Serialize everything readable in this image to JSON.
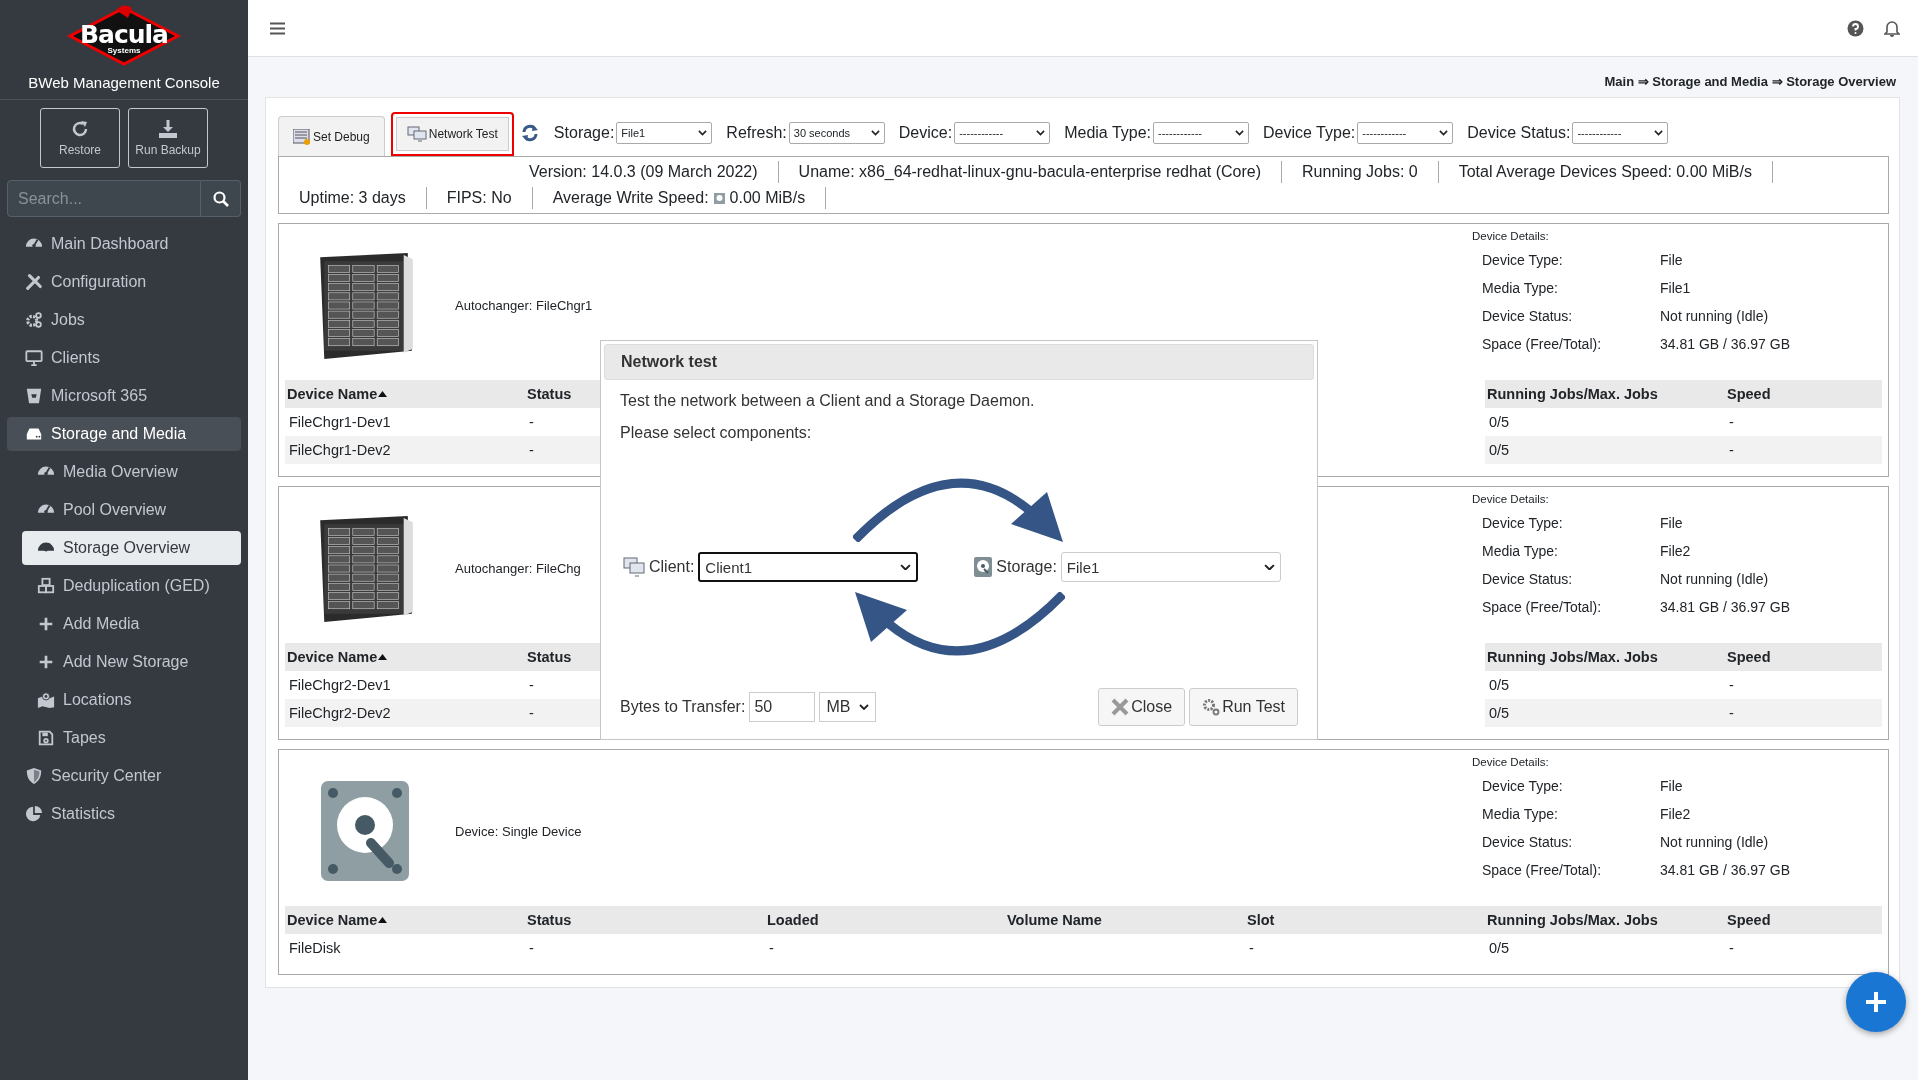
{
  "sidebar": {
    "logo": {
      "name": "Bacula",
      "subtitle": "Systems"
    },
    "title": "BWeb Management Console",
    "actions": [
      {
        "label": "Restore"
      },
      {
        "label": "Run Backup"
      }
    ],
    "search": {
      "placeholder": "Search..."
    },
    "menu": [
      {
        "label": "Main Dashboard",
        "selected": false
      },
      {
        "label": "Configuration",
        "selected": false
      },
      {
        "label": "Jobs",
        "selected": false
      },
      {
        "label": "Clients",
        "selected": false
      },
      {
        "label": "Microsoft 365",
        "selected": false
      },
      {
        "label": "Storage and Media",
        "selected": true,
        "children": [
          {
            "label": "Media Overview",
            "selected": false
          },
          {
            "label": "Pool Overview",
            "selected": false
          },
          {
            "label": "Storage Overview",
            "selected": true
          },
          {
            "label": "Deduplication (GED)",
            "selected": false
          },
          {
            "label": "Add Media",
            "selected": false
          },
          {
            "label": "Add New Storage",
            "selected": false
          },
          {
            "label": "Locations",
            "selected": false
          },
          {
            "label": "Tapes",
            "selected": false
          }
        ]
      },
      {
        "label": "Security Center",
        "selected": false
      },
      {
        "label": "Statistics",
        "selected": false
      }
    ]
  },
  "breadcrumb": "Main ⇒ Storage and Media ⇒ Storage Overview",
  "toolbar": {
    "tabs": [
      {
        "label": "Set Debug",
        "highlighted": false
      },
      {
        "label": "Network Test",
        "highlighted": true
      }
    ],
    "filters": [
      {
        "label": "Storage:",
        "value": "File1"
      },
      {
        "label": "Refresh:",
        "value": "30 seconds"
      },
      {
        "label": "Device:",
        "value": "------------"
      },
      {
        "label": "Media Type:",
        "value": "------------"
      },
      {
        "label": "Device Type:",
        "value": "------------"
      },
      {
        "label": "Device Status:",
        "value": "------------"
      }
    ]
  },
  "info": [
    {
      "kind": "text",
      "text": "Version: 14.0.3 (09 March 2022)"
    },
    {
      "kind": "text",
      "text": "Uname: x86_64-redhat-linux-gnu-bacula-enterprise redhat (Core)"
    },
    {
      "kind": "text",
      "text": "Running Jobs: 0"
    },
    {
      "kind": "text",
      "text": "Total Average Devices Speed: 0.00 MiB/s"
    },
    {
      "kind": "text",
      "text": "Uptime: 3 days"
    },
    {
      "kind": "text",
      "text": "FIPS: No"
    },
    {
      "kind": "speed",
      "label": "Average Write Speed:",
      "value": "0.00 MiB/s"
    }
  ],
  "panels": [
    {
      "kind": "autochanger",
      "label": "Autochanger: FileChgr1",
      "details_title": "Device Details:",
      "details": [
        {
          "label": "Device Type:",
          "value": "File"
        },
        {
          "label": "Media Type:",
          "value": "File1"
        },
        {
          "label": "Device Status:",
          "value": "Not running (Idle)"
        },
        {
          "label": "Space (Free/Total):",
          "value": "34.81 GB / 36.97 GB"
        }
      ],
      "columns": [
        {
          "label": "Device Name",
          "sorted": true
        },
        {
          "label": "Status",
          "sorted": false
        },
        {
          "label": "Running Jobs/Max. Jobs",
          "sorted": false
        },
        {
          "label": "Speed",
          "sorted": false
        }
      ],
      "rows": [
        [
          "FileChgr1-Dev1",
          "-",
          "0/5",
          "-"
        ],
        [
          "FileChgr1-Dev2",
          "-",
          "0/5",
          "-"
        ]
      ]
    },
    {
      "kind": "autochanger",
      "label": "Autochanger: FileChg",
      "details_title": "Device Details:",
      "details": [
        {
          "label": "Device Type:",
          "value": "File"
        },
        {
          "label": "Media Type:",
          "value": "File2"
        },
        {
          "label": "Device Status:",
          "value": "Not running (Idle)"
        },
        {
          "label": "Space (Free/Total):",
          "value": "34.81 GB / 36.97 GB"
        }
      ],
      "columns": [
        {
          "label": "Device Name",
          "sorted": true
        },
        {
          "label": "Status",
          "sorted": false
        },
        {
          "label": "Running Jobs/Max. Jobs",
          "sorted": false
        },
        {
          "label": "Speed",
          "sorted": false
        }
      ],
      "rows": [
        [
          "FileChgr2-Dev1",
          "-",
          "0/5",
          "-"
        ],
        [
          "FileChgr2-Dev2",
          "-",
          "0/5",
          "-"
        ]
      ]
    },
    {
      "kind": "disk",
      "label": "Device: Single Device",
      "details_title": "Device Details:",
      "details": [
        {
          "label": "Device Type:",
          "value": "File"
        },
        {
          "label": "Media Type:",
          "value": "File2"
        },
        {
          "label": "Device Status:",
          "value": "Not running (Idle)"
        },
        {
          "label": "Space (Free/Total):",
          "value": "34.81 GB / 36.97 GB"
        }
      ],
      "columns": [
        {
          "label": "Device Name",
          "sorted": true
        },
        {
          "label": "Status",
          "sorted": false
        },
        {
          "label": "Loaded",
          "sorted": false
        },
        {
          "label": "Volume Name",
          "sorted": false
        },
        {
          "label": "Slot",
          "sorted": false
        },
        {
          "label": "Running Jobs/Max. Jobs",
          "sorted": false
        },
        {
          "label": "Speed",
          "sorted": false
        }
      ],
      "rows": [
        [
          "FileDisk",
          "-",
          "-",
          null,
          "-",
          "0/5",
          "-"
        ]
      ]
    }
  ],
  "dialog": {
    "title": "Network test",
    "intro": "Test the network between a Client and a Storage Daemon.",
    "prompt": "Please select components:",
    "client": {
      "label": "Client:",
      "value": "Client1",
      "focused": true
    },
    "storage": {
      "label": "Storage:",
      "value": "File1"
    },
    "bytes": {
      "label": "Bytes to Transfer:",
      "value": "50",
      "unit": "MB"
    },
    "buttons": [
      {
        "label": "Close"
      },
      {
        "label": "Run Test"
      }
    ]
  }
}
